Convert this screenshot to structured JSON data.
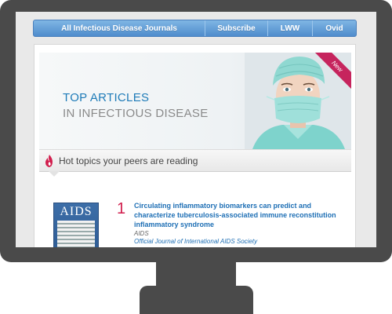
{
  "nav": {
    "journals": "All Infectious Disease Journals",
    "subscribe": "Subscribe",
    "lww": "LWW",
    "ovid": "Ovid"
  },
  "hero": {
    "title_line1": "TOP ARTICLES",
    "title_line2": "IN INFECTIOUS DISEASE",
    "badge": "New"
  },
  "hot_topics": {
    "icon": "flame-icon",
    "label": "Hot topics your peers are reading"
  },
  "articles": [
    {
      "rank": "1",
      "cover_title": "AIDS",
      "title": "Circulating inflammatory biomarkers can predict and characterize tuberculosis-associated immune reconstitution inflammatory syndrome",
      "journal": "AIDS",
      "society": "Official Journal of International AIDS Society"
    }
  ],
  "colors": {
    "nav_blue": "#5a97d3",
    "accent_pink": "#c6245d",
    "link_blue": "#1e6fb5",
    "monitor": "#4a4a4a"
  }
}
